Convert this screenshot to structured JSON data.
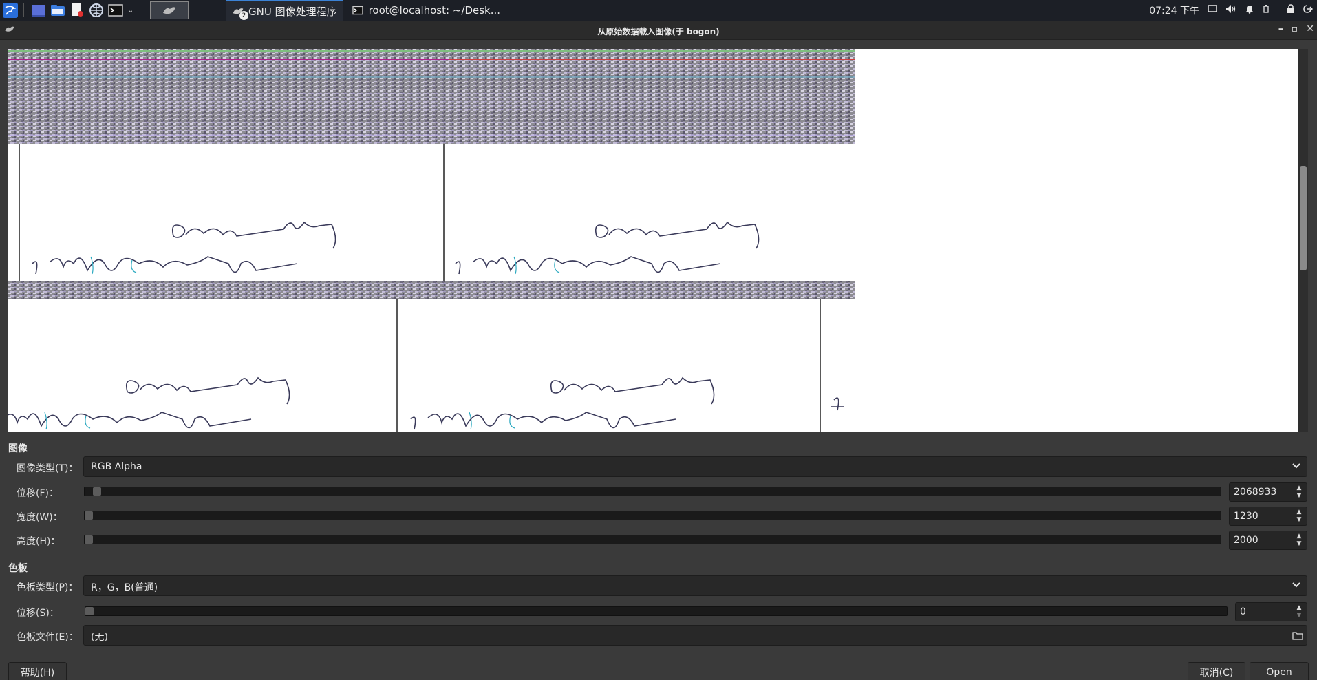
{
  "taskbar": {
    "tasks": [
      {
        "label": "GNU 图像处理程序",
        "badge": "2"
      },
      {
        "label": "root@localhost: ~/Desk..."
      }
    ],
    "clock": "07:24 下午"
  },
  "window": {
    "title": "从原始数据载入图像(于 bogon)"
  },
  "image_section": {
    "heading": "图像",
    "image_type": {
      "label": "图像类型(T)：",
      "value": "RGB Alpha"
    },
    "offset": {
      "label": "位移(F)：",
      "value": "2068933"
    },
    "width": {
      "label": "宽度(W)：",
      "value": "1230"
    },
    "height": {
      "label": "高度(H)：",
      "value": "2000"
    }
  },
  "palette_section": {
    "heading": "色板",
    "palette_type": {
      "label": "色板类型(P)：",
      "value": "R，G，B(普通)"
    },
    "offset": {
      "label": "位移(S)：",
      "value": "0"
    },
    "palette_file": {
      "label": "色板文件(E)：",
      "value": "(无)"
    }
  },
  "buttons": {
    "help": "帮助(H)",
    "cancel": "取消(C)",
    "open": "Open"
  },
  "colors": {
    "accent": "#3b82d6",
    "panel_bg": "#1c1f26",
    "dialog_bg": "#3a3a3a"
  }
}
